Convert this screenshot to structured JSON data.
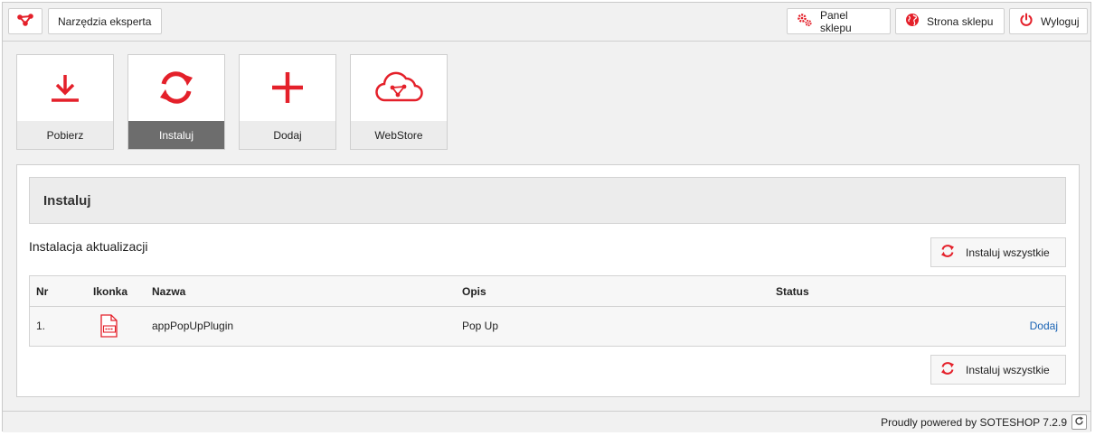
{
  "topbar": {
    "logo_icon": "soteshop-logo-icon",
    "tools_label": "Narzędzia eksperta",
    "panel_label": "Panel sklepu",
    "store_label": "Strona sklepu",
    "logout_label": "Wyloguj"
  },
  "tiles": [
    {
      "label": "Pobierz",
      "icon": "download-icon",
      "active": false
    },
    {
      "label": "Instaluj",
      "icon": "refresh-icon",
      "active": true
    },
    {
      "label": "Dodaj",
      "icon": "plus-icon",
      "active": false
    },
    {
      "label": "WebStore",
      "icon": "cloud-icon",
      "active": false
    }
  ],
  "panel": {
    "title": "Instaluj",
    "section_title": "Instalacja aktualizacji",
    "install_all_label": "Instaluj wszystkie"
  },
  "table": {
    "headers": {
      "nr": "Nr",
      "icon": "Ikonka",
      "name": "Nazwa",
      "desc": "Opis",
      "status": "Status"
    },
    "rows": [
      {
        "nr": "1.",
        "icon": "app-file-icon",
        "name": "appPopUpPlugin",
        "desc": "Pop Up",
        "action": "Dodaj"
      }
    ]
  },
  "footer": {
    "text": "Proudly powered by SOTESHOP 7.2.9"
  },
  "colors": {
    "accent": "#e4202a",
    "link": "#1a63b4",
    "active_tile": "#6d6d6d"
  }
}
